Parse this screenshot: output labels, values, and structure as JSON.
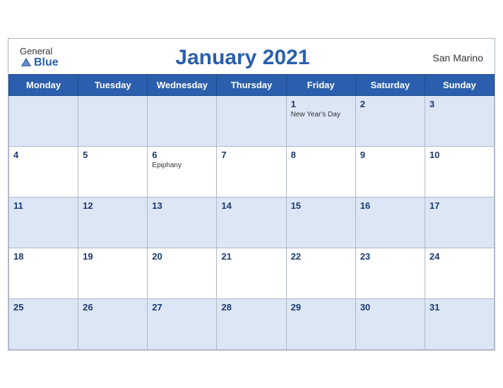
{
  "logo": {
    "general": "General",
    "blue": "Blue"
  },
  "header": {
    "title": "January 2021",
    "country": "San Marino"
  },
  "days_of_week": [
    "Monday",
    "Tuesday",
    "Wednesday",
    "Thursday",
    "Friday",
    "Saturday",
    "Sunday"
  ],
  "weeks": [
    [
      {
        "date": "",
        "holiday": ""
      },
      {
        "date": "",
        "holiday": ""
      },
      {
        "date": "",
        "holiday": ""
      },
      {
        "date": "",
        "holiday": ""
      },
      {
        "date": "1",
        "holiday": "New Year's Day"
      },
      {
        "date": "2",
        "holiday": ""
      },
      {
        "date": "3",
        "holiday": ""
      }
    ],
    [
      {
        "date": "4",
        "holiday": ""
      },
      {
        "date": "5",
        "holiday": ""
      },
      {
        "date": "6",
        "holiday": "Epiphany"
      },
      {
        "date": "7",
        "holiday": ""
      },
      {
        "date": "8",
        "holiday": ""
      },
      {
        "date": "9",
        "holiday": ""
      },
      {
        "date": "10",
        "holiday": ""
      }
    ],
    [
      {
        "date": "11",
        "holiday": ""
      },
      {
        "date": "12",
        "holiday": ""
      },
      {
        "date": "13",
        "holiday": ""
      },
      {
        "date": "14",
        "holiday": ""
      },
      {
        "date": "15",
        "holiday": ""
      },
      {
        "date": "16",
        "holiday": ""
      },
      {
        "date": "17",
        "holiday": ""
      }
    ],
    [
      {
        "date": "18",
        "holiday": ""
      },
      {
        "date": "19",
        "holiday": ""
      },
      {
        "date": "20",
        "holiday": ""
      },
      {
        "date": "21",
        "holiday": ""
      },
      {
        "date": "22",
        "holiday": ""
      },
      {
        "date": "23",
        "holiday": ""
      },
      {
        "date": "24",
        "holiday": ""
      }
    ],
    [
      {
        "date": "25",
        "holiday": ""
      },
      {
        "date": "26",
        "holiday": ""
      },
      {
        "date": "27",
        "holiday": ""
      },
      {
        "date": "28",
        "holiday": ""
      },
      {
        "date": "29",
        "holiday": ""
      },
      {
        "date": "30",
        "holiday": ""
      },
      {
        "date": "31",
        "holiday": ""
      }
    ]
  ],
  "colors": {
    "header_bg": "#2b5fad",
    "row_odd_bg": "#dce6f5",
    "row_even_bg": "#ffffff",
    "title_color": "#2b5fad",
    "border_color": "#b0b8c8"
  }
}
